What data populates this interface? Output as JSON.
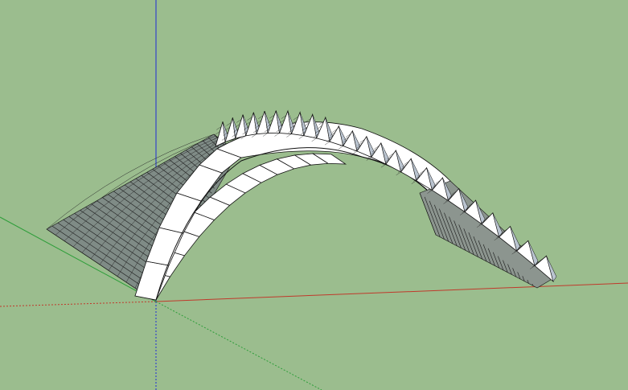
{
  "scene": {
    "background_color": "#9bbd8e",
    "axes": {
      "red_color": "#c0392b",
      "green_color": "#2e9e3a",
      "blue_color": "#1f2bd6"
    },
    "model": {
      "face_color": "#ffffff",
      "shade_color": "#b9c3cf",
      "edge_color": "#111111"
    }
  }
}
